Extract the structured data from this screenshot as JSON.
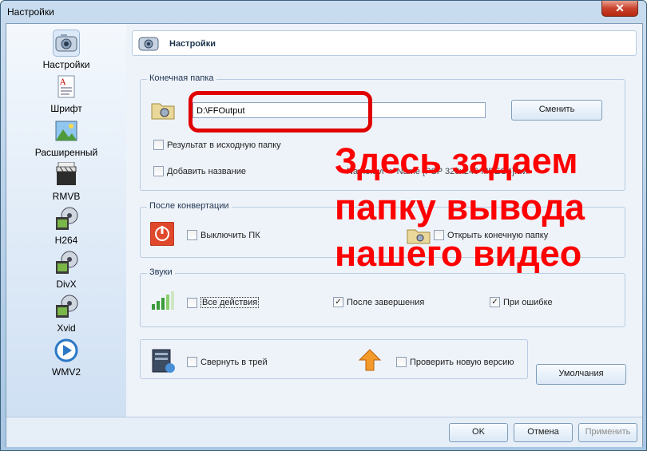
{
  "window": {
    "title": "Настройки",
    "close_label": "✕"
  },
  "sidebar": {
    "items": [
      {
        "label": "Настройки",
        "icon": "camera-settings-icon"
      },
      {
        "label": "Шрифт",
        "icon": "font-document-icon"
      },
      {
        "label": "Расширенный",
        "icon": "landscape-image-icon"
      },
      {
        "label": "RMVB",
        "icon": "rmvb-clapper-icon"
      },
      {
        "label": "H264",
        "icon": "film-reel-icon"
      },
      {
        "label": "DivX",
        "icon": "film-reel-icon"
      },
      {
        "label": "Xvid",
        "icon": "film-reel-icon"
      },
      {
        "label": "WMV2",
        "icon": "media-play-icon"
      }
    ]
  },
  "header": {
    "title": "Настройки"
  },
  "output_folder": {
    "legend": "Конечная папка",
    "path_value": "D:\\FFOutput",
    "change_button": "Сменить",
    "result_to_source_label": "Результат в исходную папку",
    "add_name_label": "Добавить название",
    "name_hint": "Name.avi -> Name [PSP 320x240 MPEG4].avi"
  },
  "after_conversion": {
    "legend": "После конвертации",
    "shutdown_label": "Выключить ПК",
    "open_folder_label": "Открыть конечную папку"
  },
  "sounds": {
    "legend": "Звуки",
    "all_actions_label": "Все действия",
    "after_finish_label": "После завершения",
    "on_error_label": "При ошибке",
    "all_actions_checked": false,
    "after_finish_checked": true,
    "on_error_checked": true
  },
  "misc": {
    "minimize_tray_label": "Свернуть в трей",
    "check_update_label": "Проверить новую версию",
    "defaults_button": "Умолчания"
  },
  "footer": {
    "ok": "OK",
    "cancel": "Отмена",
    "apply": "Применить"
  },
  "annotation": {
    "line1": "Здесь задаем",
    "line2": "папку вывода",
    "line3": "нашего видео"
  },
  "colors": {
    "annotation": "#ff0000",
    "accent": "#1f3550"
  }
}
